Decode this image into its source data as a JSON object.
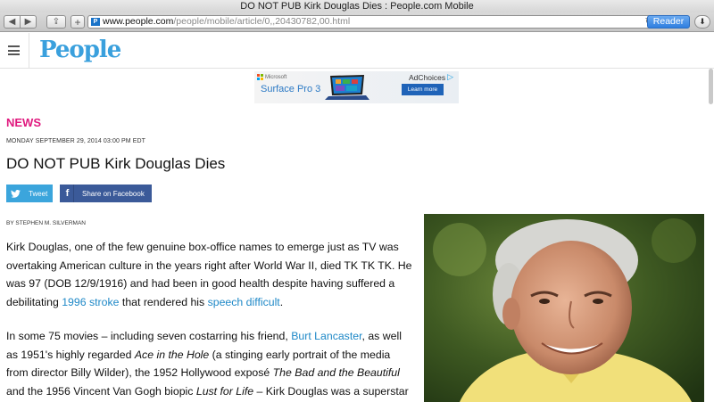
{
  "window": {
    "title": "DO NOT PUB Kirk Douglas Dies : People.com Mobile"
  },
  "toolbar": {
    "back_glyph": "◀",
    "forward_glyph": "▶",
    "share_glyph": "⇪",
    "newtab_glyph": "+",
    "url_domain": "www.people.com",
    "url_path": "/people/mobile/article/0,,20430782,00.html",
    "favicon_letter": "P",
    "reload_glyph": "↻",
    "reader_label": "Reader",
    "download_glyph": "⬇"
  },
  "site": {
    "logo": "People"
  },
  "ad": {
    "brand": "Microsoft",
    "product": "Surface Pro 3",
    "adchoices": "AdChoices",
    "cta": "Learn more"
  },
  "article": {
    "section": "NEWS",
    "dateline": "MONDAY SEPTEMBER 29, 2014 03:00 PM EDT",
    "headline": "DO NOT PUB Kirk Douglas Dies",
    "tweet_label": "Tweet",
    "facebook_label": "Share on Facebook",
    "byline": "BY STEPHEN M. SILVERMAN",
    "p1": {
      "t1": "Kirk Douglas, one of the few genuine box-office names to emerge just as TV was overtaking American culture in the years right after World War II, died TK TK TK. He was 97 (DOB 12/9/1916) and had been in good health despite having suffered a debilitating ",
      "link1": "1996 stroke",
      "t2": " that rendered his ",
      "link2": "speech difficult",
      "t3": "."
    },
    "p2": {
      "t1": "In some 75 movies – including seven costarring his friend, ",
      "link1": "Burt Lancaster",
      "t2": ", as well as 1951's highly regarded ",
      "em1": "Ace in the Hole",
      "t3": " (a stinging early portrait of the media from director Billy Wilder), the 1952 Hollywood exposé ",
      "em2": "The Bad and the Beautiful",
      "t4": " and the 1956 Vincent Van Gogh biopic ",
      "em3": "Lust for Life",
      "t5": " – Kirk Douglas was a superstar even"
    }
  },
  "colors": {
    "accent_pink": "#e0197e",
    "link_blue": "#1e88c7",
    "logo_blue": "#3aa0dd",
    "twitter": "#3ba5dc",
    "facebook": "#3b5a99"
  }
}
